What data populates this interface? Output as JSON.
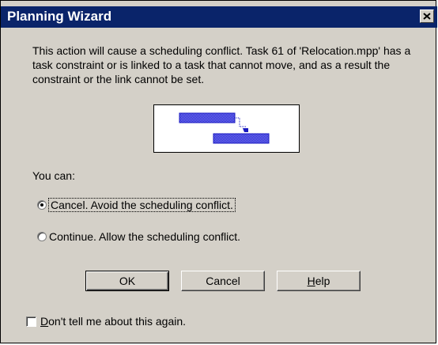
{
  "window": {
    "title": "Planning Wizard",
    "close_icon": "close-icon"
  },
  "message": {
    "text": "This action will cause a scheduling conflict.  Task 61 of 'Relocation.mpp' has a task constraint or is linked to a task that cannot move, and as a result the constraint or the link cannot be set."
  },
  "diagram": {
    "icon": "gantt-link-conflict-diagram",
    "bar_color": "#2b2bd8"
  },
  "options": {
    "prompt": "You can:",
    "cancel_option": "Cancel.  Avoid the scheduling conflict.",
    "continue_option": "Continue.  Allow the scheduling conflict.",
    "selected": "cancel"
  },
  "buttons": {
    "ok": "OK",
    "cancel": "Cancel",
    "help_prefix": "",
    "help_mnemonic": "H",
    "help_rest": "elp"
  },
  "checkbox": {
    "mnemonic": "D",
    "rest": "on't tell me about this again.",
    "checked": false
  }
}
